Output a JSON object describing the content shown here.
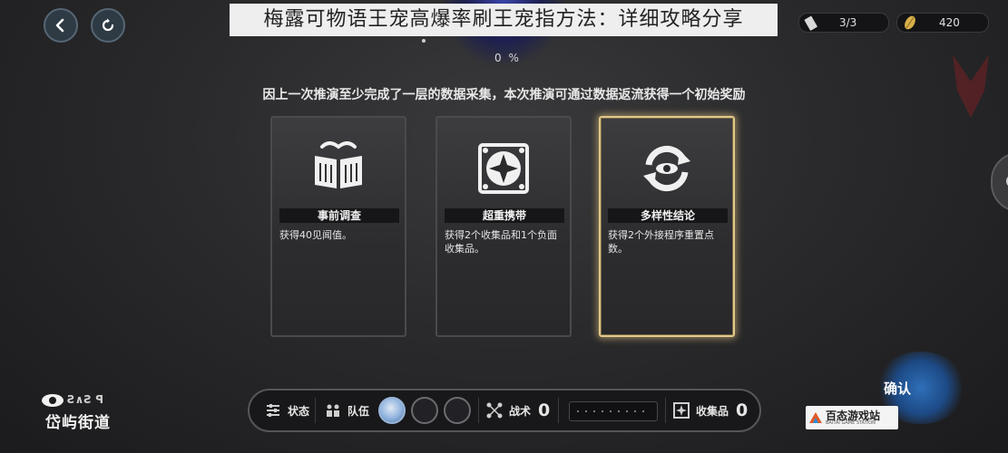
{
  "title_banner": "梅露可物语王宠高爆率刷王宠指方法：详细攻略分享",
  "top_left": {
    "back_icon": "back-arrow-icon",
    "refresh_icon": "refresh-icon"
  },
  "resources": {
    "ticket": {
      "icon": "ticket-icon",
      "value": "3/3"
    },
    "currency": {
      "icon": "feather-coin-icon",
      "value": "420"
    }
  },
  "progress_percent": "0 %",
  "headline": "因上一次推演至少完成了一层的数据采集，本次推演可通过数据返流获得一个初始奖励",
  "cards": [
    {
      "icon": "open-book-icon",
      "label": "事前调查",
      "desc": "获得40见闻值。",
      "selected": false
    },
    {
      "icon": "diamond-grid-icon",
      "label": "超重携带",
      "desc": "获得2个收集品和1个负面收集品。",
      "selected": false
    },
    {
      "icon": "cycle-arrows-icon",
      "label": "多样性结论",
      "desc": "获得2个外接程序重置点数。",
      "selected": true
    }
  ],
  "bottom_bar": {
    "status_label": "状态",
    "team_label": "队伍",
    "tactics_label": "战术",
    "tactics_count": "0",
    "collectibles_label": "收集品",
    "collectibles_count": "0"
  },
  "logo": {
    "sub": "Ƨ∧Ƨ ꟼ",
    "main": "岱屿街道"
  },
  "confirm_label": "确认",
  "watermark": {
    "main": "百态游戏站",
    "sub": "BAITAI GAME STATION"
  },
  "colors": {
    "selected_border": "#e2c88a",
    "accent_blue": "#2f6fb8"
  }
}
